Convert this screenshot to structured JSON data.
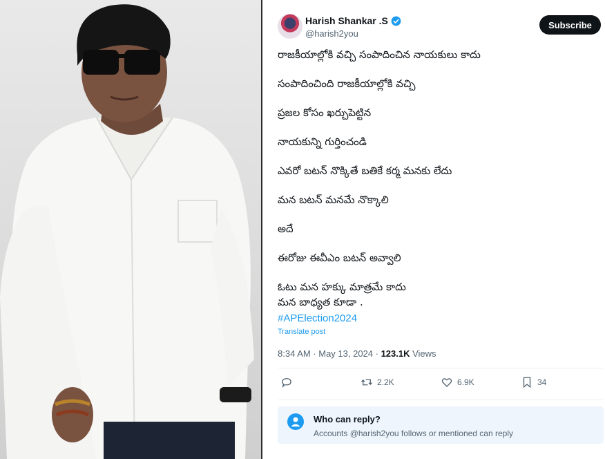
{
  "photo": {
    "alt_icon": "person-photo"
  },
  "tweet": {
    "author": {
      "name": "Harish Shankar .S",
      "handle": "@harish2you",
      "verified_icon": "verified-badge-icon"
    },
    "subscribe_label": "Subscribe",
    "lines": [
      "రాజకీయాల్లోకి వచ్చి సంపాదించిన నాయకులు కాదు",
      "సంపాదించింది రాజకీయాల్లోకి వచ్చి",
      "ప్రజల కోసం ఖర్చుపెట్టిన",
      " నాయకున్ని గుర్తించండి",
      "ఎవరో బటన్ నొక్కితే బతికే కర్మ మనకు లేదు",
      "మన బటన్ మనమే  నొక్కాలి",
      "అదే",
      "ఈరోజు ఈవీఎం బటన్ అవ్వాలి",
      "ఓటు మన హక్కు మాత్రమే కాదు",
      "మన బాధ్యత కూడా ."
    ],
    "hashtag": "#APElection2024",
    "translate_label": "Translate post",
    "timestamp": "8:34 AM · May 13, 2024 · ",
    "views_count": "123.1K",
    "views_label": " Views",
    "actions": {
      "reply_icon": "comment-icon",
      "retweet_icon": "retweet-icon",
      "retweets": "2.2K",
      "like_icon": "heart-icon",
      "likes": "6.9K",
      "bookmark_icon": "bookmark-icon",
      "bookmarks": "34"
    },
    "who_can_reply": {
      "title": "Who can reply?",
      "subtitle": "Accounts @harish2you follows or mentioned can reply",
      "icon": "person-icon"
    }
  },
  "colors": {
    "link": "#1d9bf0",
    "text": "#0f1419",
    "muted": "#536471",
    "reply_bg": "#eef5fc"
  }
}
